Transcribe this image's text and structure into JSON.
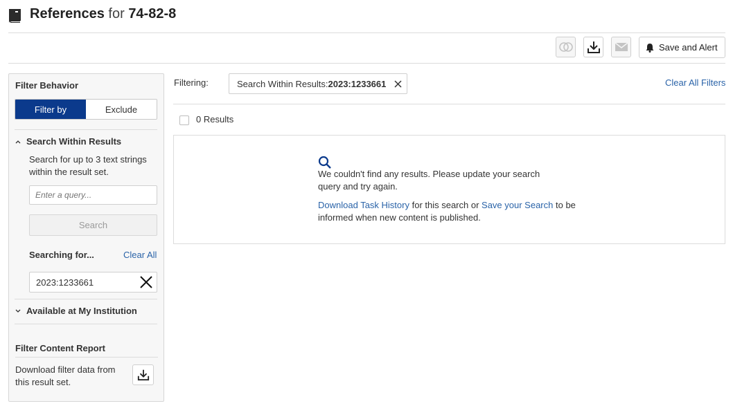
{
  "header": {
    "title_main": "References",
    "title_for": "for",
    "title_id": "74-82-8"
  },
  "toolbar": {
    "save_alert_label": "Save and Alert"
  },
  "sidebar": {
    "filter_behavior_heading": "Filter Behavior",
    "filter_by_label": "Filter by",
    "exclude_label": "Exclude",
    "search_within_heading": "Search Within Results",
    "search_within_desc_line1": "Search for up to 3 text strings",
    "search_within_desc_line2": "within the result set.",
    "query_placeholder": "Enter a query...",
    "search_button_label": "Search",
    "searching_for_label": "Searching for...",
    "clear_all_label": "Clear All",
    "search_term": "2023:1233661",
    "available_heading": "Available at My Institution",
    "report_heading": "Filter Content Report",
    "report_desc_line1": "Download filter data from",
    "report_desc_line2": "this result set."
  },
  "main": {
    "filtering_label": "Filtering:",
    "chip_prefix": "Search Within Results: ",
    "chip_value": "2023:1233661",
    "clear_all_filters_label": "Clear All Filters",
    "results_count_label": "0 Results",
    "no_results_line1": "We couldn't find any results. Please update your search",
    "no_results_line2": "query and try again.",
    "download_task_history_link": "Download Task History",
    "for_this_search_text": " for this search or ",
    "save_search_link": "Save your Search",
    "to_be_text": " to be",
    "informed_text": "informed when new content is published."
  },
  "colors": {
    "accent": "#0b3a8c",
    "link": "#2a63a8"
  }
}
